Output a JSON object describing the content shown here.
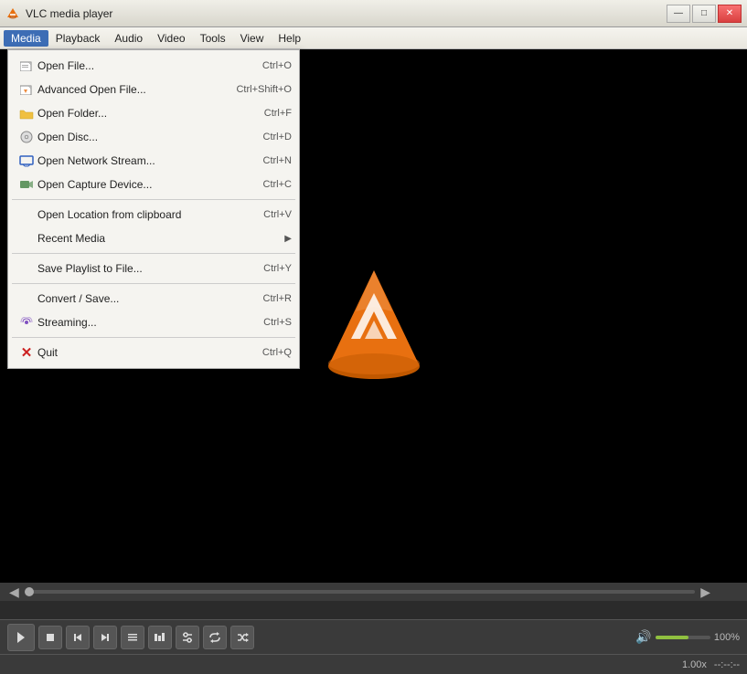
{
  "window": {
    "title": "VLC media player",
    "controls": {
      "minimize": "—",
      "maximize": "□",
      "close": "✕"
    }
  },
  "menubar": {
    "items": [
      {
        "id": "media",
        "label": "Media",
        "active": true
      },
      {
        "id": "playback",
        "label": "Playback",
        "active": false
      },
      {
        "id": "audio",
        "label": "Audio",
        "active": false
      },
      {
        "id": "video",
        "label": "Video",
        "active": false
      },
      {
        "id": "tools",
        "label": "Tools",
        "active": false
      },
      {
        "id": "view",
        "label": "View",
        "active": false
      },
      {
        "id": "help",
        "label": "Help",
        "active": false
      }
    ]
  },
  "dropdown": {
    "items": [
      {
        "id": "open-file",
        "label": "Open File...",
        "shortcut": "Ctrl+O",
        "icon": "file",
        "separator_after": false
      },
      {
        "id": "advanced-open",
        "label": "Advanced Open File...",
        "shortcut": "Ctrl+Shift+O",
        "icon": "file-adv",
        "separator_after": false
      },
      {
        "id": "open-folder",
        "label": "Open Folder...",
        "shortcut": "Ctrl+F",
        "icon": "folder",
        "separator_after": false
      },
      {
        "id": "open-disc",
        "label": "Open Disc...",
        "shortcut": "Ctrl+D",
        "icon": "disc",
        "separator_after": false
      },
      {
        "id": "open-network",
        "label": "Open Network Stream...",
        "shortcut": "Ctrl+N",
        "icon": "network",
        "separator_after": false
      },
      {
        "id": "open-capture",
        "label": "Open Capture Device...",
        "shortcut": "Ctrl+C",
        "icon": "capture",
        "separator_after": true
      },
      {
        "id": "open-location",
        "label": "Open Location from clipboard",
        "shortcut": "Ctrl+V",
        "icon": "",
        "separator_after": false
      },
      {
        "id": "recent-media",
        "label": "Recent Media",
        "shortcut": "",
        "icon": "",
        "arrow": "▶",
        "separator_after": true
      },
      {
        "id": "save-playlist",
        "label": "Save Playlist to File...",
        "shortcut": "Ctrl+Y",
        "icon": "",
        "separator_after": true
      },
      {
        "id": "convert-save",
        "label": "Convert / Save...",
        "shortcut": "Ctrl+R",
        "icon": "",
        "separator_after": false
      },
      {
        "id": "streaming",
        "label": "Streaming...",
        "shortcut": "Ctrl+S",
        "icon": "stream",
        "separator_after": true
      },
      {
        "id": "quit",
        "label": "Quit",
        "shortcut": "Ctrl+Q",
        "icon": "quit",
        "separator_after": false
      }
    ]
  },
  "controls": {
    "play_symbol": "▶",
    "stop_symbol": "■",
    "prev_symbol": "⏮",
    "next_symbol": "⏭",
    "rewind_symbol": "⏪",
    "volume_icon": "🔊",
    "volume_percent": "100%",
    "speed": "1.00x",
    "time": "--:--:--"
  },
  "status": {
    "speed": "1.00x",
    "time": "--:--:--"
  }
}
